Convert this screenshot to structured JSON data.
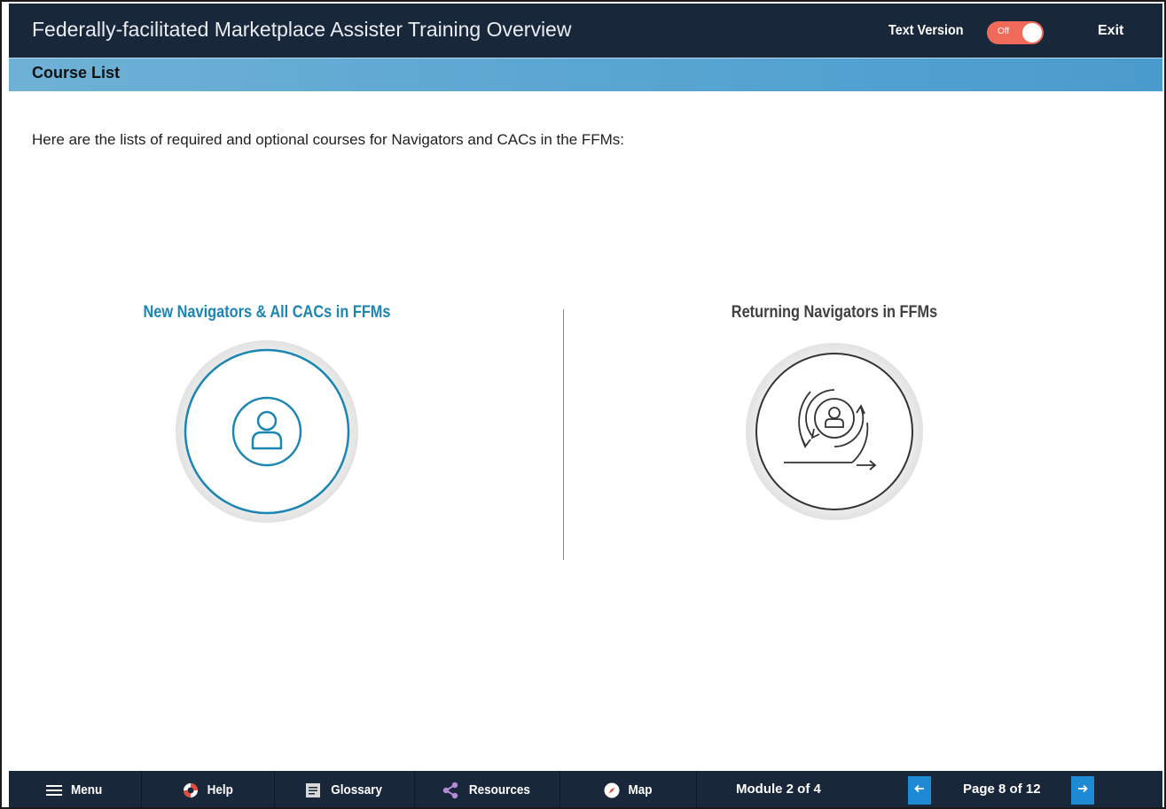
{
  "header": {
    "title": "Federally-facilitated Marketplace Assister Training Overview",
    "text_version_label": "Text Version",
    "toggle_state": "Off",
    "exit_label": "Exit"
  },
  "section": {
    "title": "Course List"
  },
  "intro": "Here are the lists of required and optional courses for Navigators and CACs in the FFMs:",
  "options": [
    {
      "label": "New Navigators & All CACs in FFMs",
      "icon": "person-icon"
    },
    {
      "label": "Returning Navigators in FFMs",
      "icon": "returning-person-icon"
    }
  ],
  "footer": {
    "menu": "Menu",
    "help": "Help",
    "glossary": "Glossary",
    "resources": "Resources",
    "map": "Map",
    "module": "Module 2 of 4",
    "page": "Page 8 of 12"
  },
  "colors": {
    "header_bg": "#18273a",
    "accent_blue": "#1c86b3",
    "toggle_off": "#f06a5a",
    "nav_button": "#1e8ad4"
  }
}
